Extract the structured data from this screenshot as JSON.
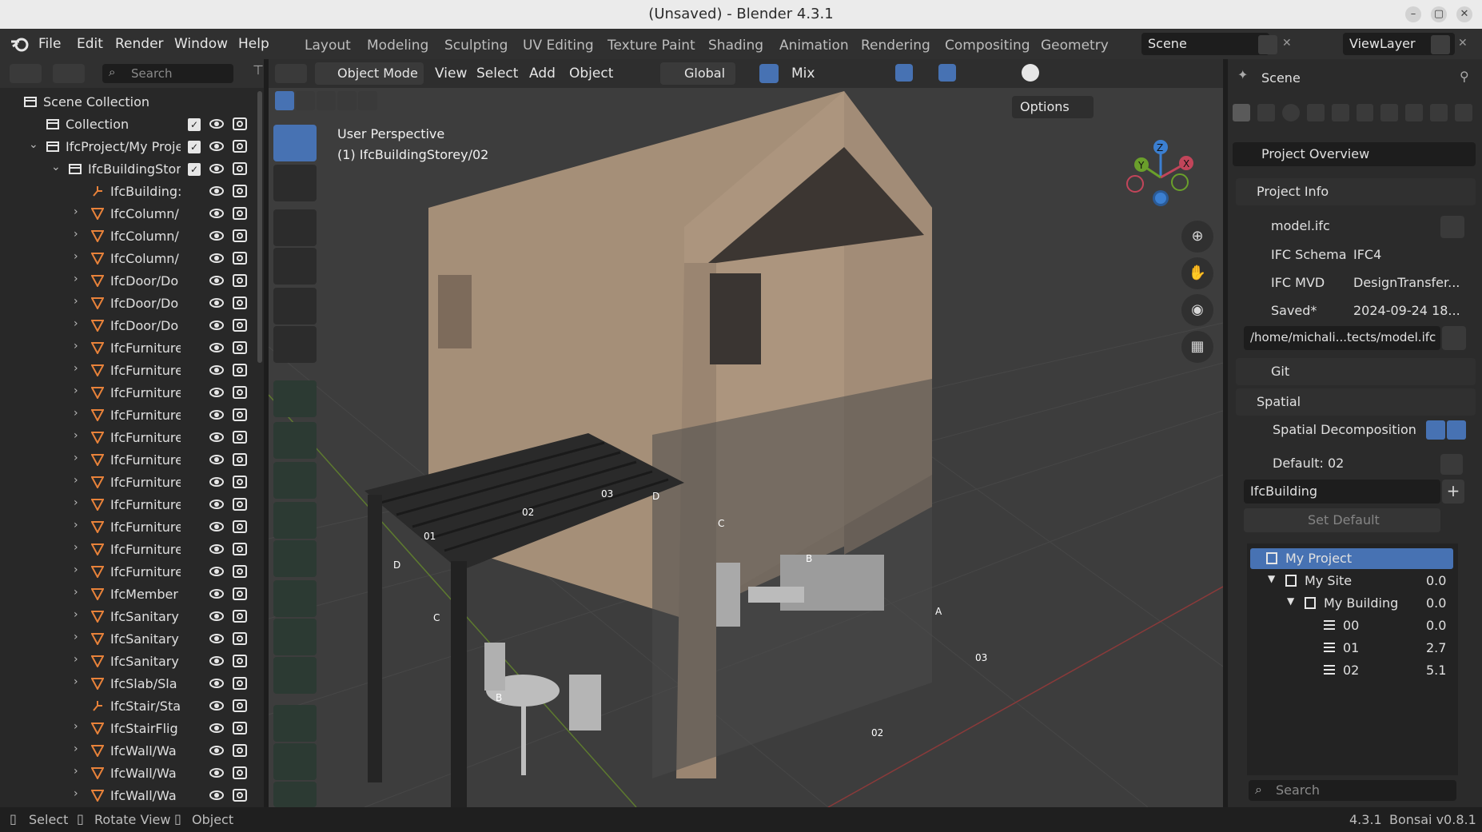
{
  "window": {
    "title": "(Unsaved) - Blender 4.3.1"
  },
  "menu": [
    "File",
    "Edit",
    "Render",
    "Window",
    "Help"
  ],
  "workspaces": [
    "Layout",
    "Modeling",
    "Sculpting",
    "UV Editing",
    "Texture Paint",
    "Shading",
    "Animation",
    "Rendering",
    "Compositing",
    "Geometry"
  ],
  "scene_field": "Scene",
  "viewlayer_field": "ViewLayer",
  "outliner": {
    "search_placeholder": "Search",
    "rows": [
      {
        "label": "Scene Collection",
        "indent": 0,
        "chev": "",
        "icon": "collection-icon",
        "check": false
      },
      {
        "label": "Collection",
        "indent": 1,
        "chev": "",
        "icon": "collection-icon",
        "check": true
      },
      {
        "label": "IfcProject/My Proje",
        "indent": 1,
        "chev": "⌄",
        "icon": "collection-icon",
        "check": true
      },
      {
        "label": "IfcBuildingStor",
        "indent": 2,
        "chev": "⌄",
        "icon": "collection-icon",
        "check": true
      },
      {
        "label": "IfcBuilding:",
        "indent": 3,
        "chev": "",
        "icon": "empty-icon",
        "check": false
      },
      {
        "label": "IfcColumn/",
        "indent": 3,
        "chev": "›",
        "icon": "mesh-icon",
        "check": false
      },
      {
        "label": "IfcColumn/",
        "indent": 3,
        "chev": "›",
        "icon": "mesh-icon",
        "check": false
      },
      {
        "label": "IfcColumn/",
        "indent": 3,
        "chev": "›",
        "icon": "mesh-icon",
        "check": false
      },
      {
        "label": "IfcDoor/Do",
        "indent": 3,
        "chev": "›",
        "icon": "mesh-icon",
        "check": false
      },
      {
        "label": "IfcDoor/Do",
        "indent": 3,
        "chev": "›",
        "icon": "mesh-icon",
        "check": false
      },
      {
        "label": "IfcDoor/Do",
        "indent": 3,
        "chev": "›",
        "icon": "mesh-icon",
        "check": false
      },
      {
        "label": "IfcFurniture",
        "indent": 3,
        "chev": "›",
        "icon": "mesh-icon",
        "check": false
      },
      {
        "label": "IfcFurniture",
        "indent": 3,
        "chev": "›",
        "icon": "mesh-icon",
        "check": false
      },
      {
        "label": "IfcFurniture",
        "indent": 3,
        "chev": "›",
        "icon": "mesh-icon",
        "check": false
      },
      {
        "label": "IfcFurniture",
        "indent": 3,
        "chev": "›",
        "icon": "mesh-icon",
        "check": false
      },
      {
        "label": "IfcFurniture",
        "indent": 3,
        "chev": "›",
        "icon": "mesh-icon",
        "check": false
      },
      {
        "label": "IfcFurniture",
        "indent": 3,
        "chev": "›",
        "icon": "mesh-icon",
        "check": false
      },
      {
        "label": "IfcFurniture",
        "indent": 3,
        "chev": "›",
        "icon": "mesh-icon",
        "check": false
      },
      {
        "label": "IfcFurniture",
        "indent": 3,
        "chev": "›",
        "icon": "mesh-icon",
        "check": false
      },
      {
        "label": "IfcFurniture",
        "indent": 3,
        "chev": "›",
        "icon": "mesh-icon",
        "check": false
      },
      {
        "label": "IfcFurniture",
        "indent": 3,
        "chev": "›",
        "icon": "mesh-icon",
        "check": false
      },
      {
        "label": "IfcFurniture",
        "indent": 3,
        "chev": "›",
        "icon": "mesh-icon",
        "check": false
      },
      {
        "label": "IfcMember",
        "indent": 3,
        "chev": "›",
        "icon": "mesh-icon",
        "check": false
      },
      {
        "label": "IfcSanitary",
        "indent": 3,
        "chev": "›",
        "icon": "mesh-icon",
        "check": false
      },
      {
        "label": "IfcSanitary",
        "indent": 3,
        "chev": "›",
        "icon": "mesh-icon",
        "check": false
      },
      {
        "label": "IfcSanitary",
        "indent": 3,
        "chev": "›",
        "icon": "mesh-icon",
        "check": false
      },
      {
        "label": "IfcSlab/Sla",
        "indent": 3,
        "chev": "›",
        "icon": "mesh-icon",
        "check": false
      },
      {
        "label": "IfcStair/Sta",
        "indent": 3,
        "chev": "",
        "icon": "empty-icon",
        "check": false
      },
      {
        "label": "IfcStairFlig",
        "indent": 3,
        "chev": "›",
        "icon": "mesh-icon",
        "check": false
      },
      {
        "label": "IfcWall/Wa",
        "indent": 3,
        "chev": "›",
        "icon": "mesh-icon",
        "check": false
      },
      {
        "label": "IfcWall/Wa",
        "indent": 3,
        "chev": "›",
        "icon": "mesh-icon",
        "check": false
      },
      {
        "label": "IfcWall/Wa",
        "indent": 3,
        "chev": "›",
        "icon": "mesh-icon",
        "check": false
      }
    ]
  },
  "viewport": {
    "mode": "Object Mode",
    "menus": [
      "View",
      "Select",
      "Add",
      "Object"
    ],
    "transform": "Global",
    "snap": "Mix",
    "options": "Options",
    "overlay_title": "User Perspective",
    "overlay_sub": "(1) IfcBuildingStorey/02",
    "grid_labels": [
      "01",
      "02",
      "03",
      "D",
      "D",
      "C",
      "C",
      "B",
      "B",
      "A",
      "03",
      "02"
    ],
    "colors": {
      "wall": "#a58f78",
      "pergola": "#2a2a2a",
      "grid_x": "#8a3a3a",
      "grid_y": "#5d7a2f"
    }
  },
  "properties": {
    "header": "Scene",
    "dropdown": "Project Overview",
    "project_info": {
      "title": "Project Info",
      "file": "model.ifc",
      "schema_label": "IFC Schema",
      "schema_value": "IFC4",
      "mvd_label": "IFC MVD",
      "mvd_value": "DesignTransfer...",
      "saved_label": "Saved*",
      "saved_value": "2024-09-24 18...",
      "path": "/home/michali...tects/model.ifc",
      "git": "Git"
    },
    "spatial": {
      "title": "Spatial",
      "decomp": "Spatial Decomposition",
      "default": "Default: 02",
      "building": "IfcBuilding",
      "set_default": "Set Default",
      "tree": [
        {
          "label": "My Project",
          "value": "",
          "depth": 0,
          "icon": "project-icon",
          "selected": true
        },
        {
          "label": "My Site",
          "value": "0.0",
          "depth": 1,
          "icon": "site-icon",
          "selected": false
        },
        {
          "label": "My Building",
          "value": "0.0",
          "depth": 2,
          "icon": "building-icon",
          "selected": false
        },
        {
          "label": "00",
          "value": "0.0",
          "depth": 3,
          "icon": "storey-icon",
          "selected": false
        },
        {
          "label": "01",
          "value": "2.7",
          "depth": 3,
          "icon": "storey-icon",
          "selected": false
        },
        {
          "label": "02",
          "value": "5.1",
          "depth": 3,
          "icon": "storey-icon",
          "selected": false
        }
      ],
      "search_placeholder": "Search"
    }
  },
  "status": {
    "select": "Select",
    "rotate": "Rotate View",
    "object": "Object",
    "version": "4.3.1",
    "bonsai": "Bonsai v0.8.1"
  }
}
